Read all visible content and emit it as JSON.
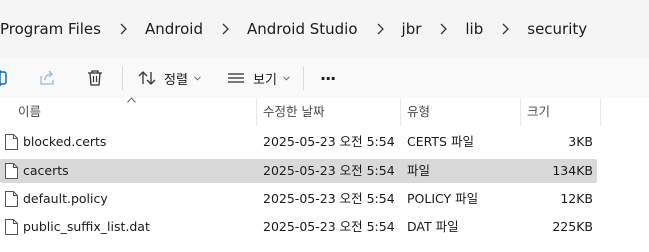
{
  "breadcrumb": {
    "items": [
      "Program Files",
      "Android",
      "Android Studio",
      "jbr",
      "lib",
      "security"
    ]
  },
  "toolbar": {
    "sort_label": "정렬",
    "view_label": "보기",
    "more_label": "···"
  },
  "columns": {
    "name": "이름",
    "date": "수정한 날짜",
    "type": "유형",
    "size": "크기"
  },
  "files": [
    {
      "name": "blocked.certs",
      "date": "2025-05-23 오전 5:54",
      "type": "CERTS 파일",
      "size": "3KB",
      "selected": false
    },
    {
      "name": "cacerts",
      "date": "2025-05-23 오전 5:54",
      "type": "파일",
      "size": "134KB",
      "selected": true
    },
    {
      "name": "default.policy",
      "date": "2025-05-23 오전 5:54",
      "type": "POLICY 파일",
      "size": "12KB",
      "selected": false
    },
    {
      "name": "public_suffix_list.dat",
      "date": "2025-05-23 오전 5:54",
      "type": "DAT 파일",
      "size": "225KB",
      "selected": false
    }
  ],
  "colors": {
    "selected_row": "#d9d9d9",
    "accent": "#0067c0"
  }
}
